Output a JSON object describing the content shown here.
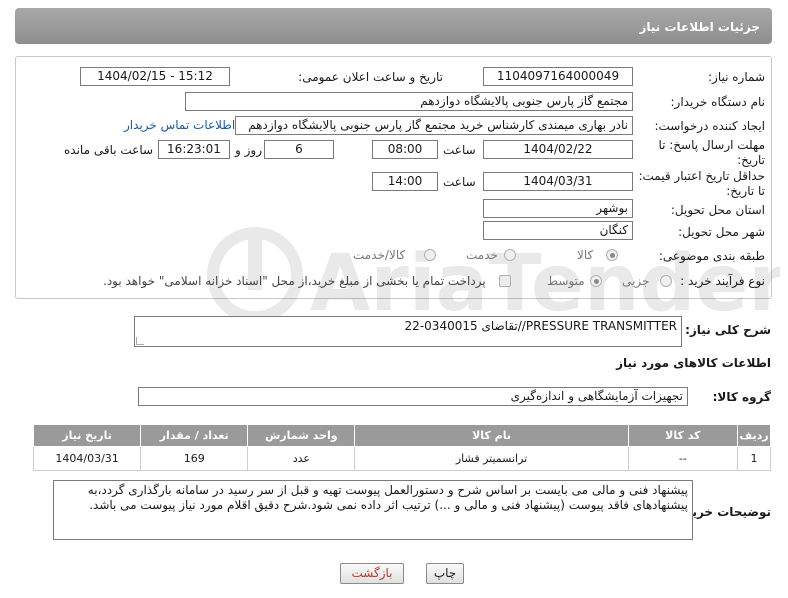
{
  "header": {
    "title": "جزئیات اطلاعات نیاز"
  },
  "form": {
    "need_number": {
      "label": "شماره نیاز:",
      "value": "1104097164000049"
    },
    "announce_datetime": {
      "label": "تاریخ و ساعت اعلان عمومی:",
      "value": "1404/02/15 - 15:12"
    },
    "buyer_org": {
      "label": "نام دستگاه خریدار:",
      "value": "مجتمع گاز پارس جنوبی  پالایشگاه دوازدهم"
    },
    "requester": {
      "label": "ایجاد کننده درخواست:",
      "value": "نادر بهاری میمندی کارشناس خرید مجتمع گاز پارس جنوبی  پالایشگاه دوازدهم",
      "contact_link": "اطلاعات تماس خریدار"
    },
    "reply_deadline": {
      "label_line1": "مهلت ارسال پاسخ: تا",
      "label_line2": "تاریخ:",
      "date": "1404/02/22",
      "time_label": "ساعت",
      "time": "08:00",
      "days": "6",
      "days_label": "روز و",
      "remaining": "16:23:01",
      "remaining_label": "ساعت باقی مانده"
    },
    "price_validity": {
      "label_line1": "حداقل تاریخ اعتبار قیمت:",
      "label_line2": "تا تاریخ:",
      "date": "1404/03/31",
      "time_label": "ساعت",
      "time": "14:00"
    },
    "delivery_province": {
      "label": "استان محل تحویل:",
      "value": "بوشهر"
    },
    "delivery_city": {
      "label": "شهر محل تحویل:",
      "value": "کنگان"
    },
    "category": {
      "label": "طبقه بندی موضوعی:",
      "options": [
        "کالا",
        "خدمت",
        "کالا/خدمت"
      ],
      "selected": "کالا"
    },
    "purchase_process": {
      "label": "نوع فرآیند خرید :",
      "options": [
        "جزیی",
        "متوسط"
      ],
      "selected": "متوسط",
      "payment_note": "پرداخت تمام یا بخشی از مبلغ خرید،از محل \"اسناد خزانه اسلامی\" خواهد بود."
    }
  },
  "description": {
    "label": "شرح کلی نیاز:",
    "value": "PRESSURE TRANSMITTER//تقاضای 0340015-22"
  },
  "goods_info": {
    "title": "اطلاعات کالاهای مورد نیاز",
    "group_label": "گروه کالا:",
    "group_value": "تجهیزات آزمایشگاهی و اندازه‌گیری",
    "columns": [
      "ردیف",
      "کد کالا",
      "نام کالا",
      "واحد شمارش",
      "تعداد / مقدار",
      "تاریخ نیاز"
    ],
    "rows": [
      [
        "1",
        "--",
        "ترانسمیتر فشار",
        "عدد",
        "169",
        "1404/03/31"
      ]
    ]
  },
  "buyer_notes": {
    "label": "توضیحات خریدار:",
    "value": "پیشنهاد فنی و مالی می بایست بر اساس شرح و دستورالعمل پیوست تهیه و قبل از سر رسید در سامانه بارگذاری گردد،به پیشنهادهای فاقد پیوست (پیشنهاد فنی و مالی و ...) ترتیب اثر داده نمی شود.شرح دقیق اقلام مورد نیاز پیوست می باشد."
  },
  "buttons": {
    "print": "چاپ",
    "back": "بازگشت"
  },
  "watermark": {
    "text": "AriaTender.neT"
  }
}
